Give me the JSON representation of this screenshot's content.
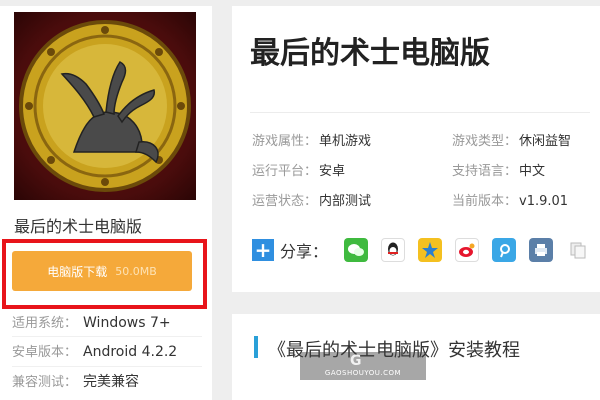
{
  "app": {
    "name": "最后的术士电脑版",
    "download_label": "电脑版下载",
    "download_size": "50.0MB"
  },
  "meta": [
    {
      "label": "适用系统：",
      "value": "Windows 7+"
    },
    {
      "label": "安卓版本：",
      "value": "Android 4.2.2"
    },
    {
      "label": "兼容测试：",
      "value": "完美兼容"
    }
  ],
  "detail": {
    "title": "最后的术士电脑版",
    "info": [
      {
        "label": "游戏属性：",
        "value": "单机游戏"
      },
      {
        "label": "游戏类型：",
        "value": "休闲益智"
      },
      {
        "label": "运行平台：",
        "value": "安卓"
      },
      {
        "label": "支持语言：",
        "value": "中文"
      },
      {
        "label": "运营状态：",
        "value": "内部测试"
      },
      {
        "label": "当前版本：",
        "value": "v1.9.01"
      }
    ],
    "share_label": "分享："
  },
  "section": {
    "title": "《最后的术士电脑版》安装教程"
  },
  "watermark": {
    "text": "GAOSHOUYOU.COM"
  },
  "colors": {
    "download_button": "#f5a93a",
    "highlight_frame": "#e8141a",
    "section_bar": "#2aa0d8"
  }
}
